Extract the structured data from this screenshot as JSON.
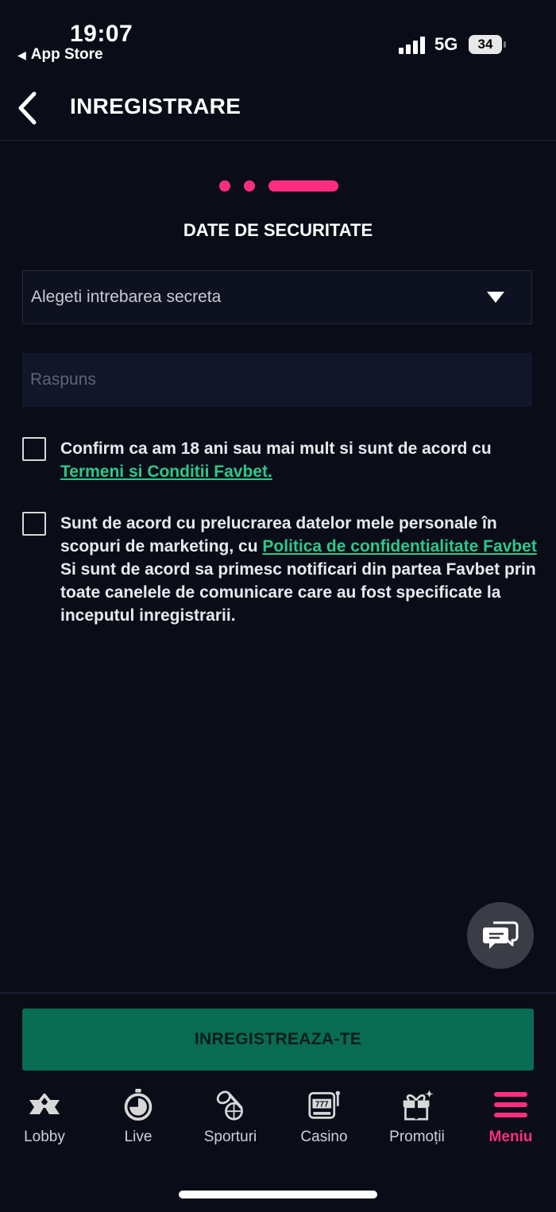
{
  "status_bar": {
    "time": "19:07",
    "back_app": "App Store",
    "network": "5G",
    "battery": "34"
  },
  "header": {
    "title": "INREGISTRARE"
  },
  "section": {
    "title": "DATE DE SECURITATE"
  },
  "form": {
    "secret_question": "Alegeti intrebarea secreta",
    "answer_placeholder": "Raspuns",
    "consent_age_text": "Confirm ca am 18 ani sau mai mult si sunt de acord cu ",
    "consent_age_link": "Termeni si Conditii Favbet.",
    "consent_marketing_text1": "Sunt de acord cu prelucrarea datelor mele personale în scopuri de marketing, cu ",
    "consent_marketing_link": "Politica de confidentialitate Favbet",
    "consent_marketing_text2": " Si sunt de acord sa primesc notificari din partea Favbet prin toate canelele de comunicare care au fost specificate la inceputul inregistrarii."
  },
  "cta": {
    "label": "INREGISTREAZA-TE"
  },
  "tabs": [
    {
      "label": "Lobby",
      "icon": "lobby-icon"
    },
    {
      "label": "Live",
      "icon": "stopwatch-icon"
    },
    {
      "label": "Sporturi",
      "icon": "sports-icon"
    },
    {
      "label": "Casino",
      "icon": "slot-machine-icon"
    },
    {
      "label": "Promoții",
      "icon": "gift-icon"
    },
    {
      "label": "Meniu",
      "icon": "hamburger-menu-icon",
      "active": true
    }
  ],
  "colors": {
    "accent": "#ff2d7f",
    "link": "#2dc88a",
    "cta": "#086c53",
    "background": "#0a0d18"
  }
}
